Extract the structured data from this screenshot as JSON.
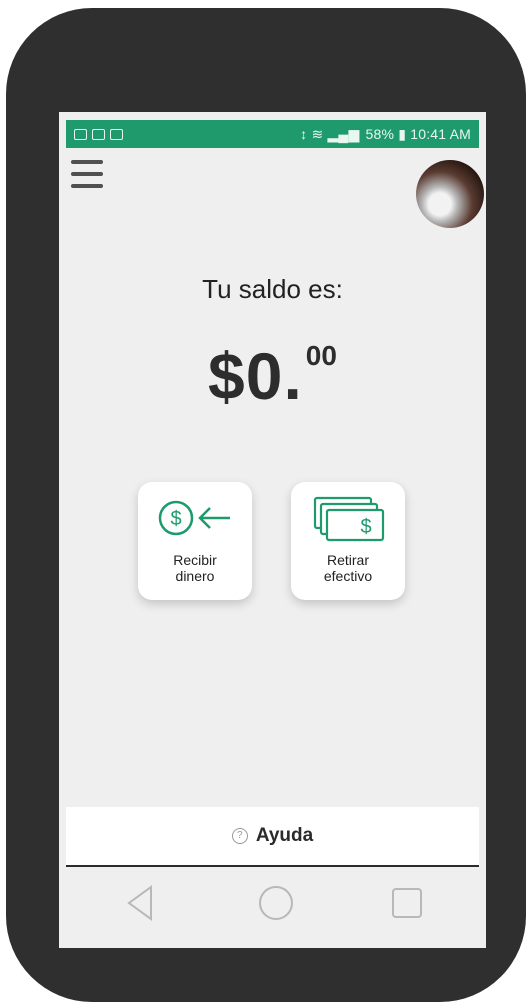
{
  "status_bar": {
    "right_text": "58% ▮ 10:41 AM"
  },
  "balance": {
    "label": "Tu saldo es:",
    "amount_main": "$0.",
    "amount_cents": "00"
  },
  "actions": {
    "receive_line1": "Recibir",
    "receive_line2": "dinero",
    "withdraw_line1": "Retirar",
    "withdraw_line2": "efectivo"
  },
  "help": {
    "icon": "?",
    "label": "Ayuda"
  },
  "colors": {
    "accent": "#1f9a6d",
    "phone_body": "#2f2f2f",
    "screen_bg": "#efefef"
  },
  "icons": {
    "menu": "hamburger-menu-icon",
    "receive": "dollar-arrow-left-icon",
    "withdraw": "cash-bill-icon",
    "help": "question-circle-icon"
  }
}
